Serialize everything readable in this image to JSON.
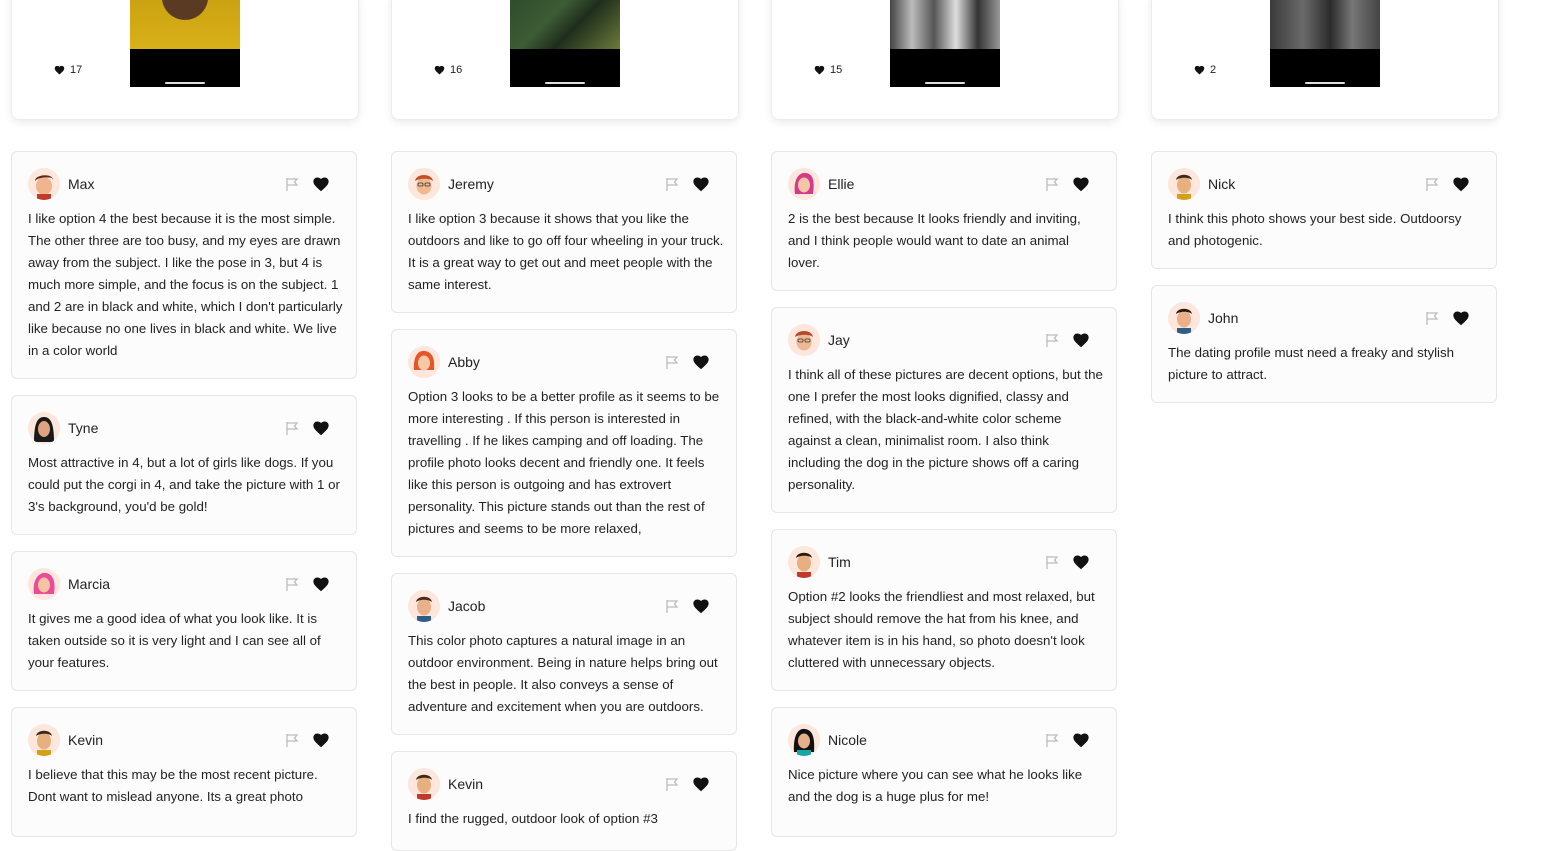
{
  "photos": [
    {
      "likes": "17"
    },
    {
      "likes": "16"
    },
    {
      "likes": "15"
    },
    {
      "likes": "2"
    }
  ],
  "columns": [
    {
      "comments": [
        {
          "name": "Max",
          "text": "I like option 4 the best because it is the most simple. The other three are too busy, and my eyes are drawn away from the subject. I like the pose in 3, but 4 is much more simple, and the focus is on the subject. 1 and 2 are in black and white, which I don't particularly like because no one lives in black and white. We live in a color world"
        },
        {
          "name": "Tyne",
          "text": "Most attractive in 4, but a lot of girls like dogs. If you could put the corgi in 4, and take the picture with 1 or 3's background, you'd be gold!"
        },
        {
          "name": "Marcia",
          "text": "It gives me a good idea of what you look like. It is taken outside so it is very light and I can see all of your features."
        },
        {
          "name": "Kevin",
          "text": "I believe that this may be the most recent picture. Dont want to mislead anyone. Its a great photo"
        }
      ]
    },
    {
      "comments": [
        {
          "name": "Jeremy",
          "text": "I like option 3 because it shows that you like the outdoors and like to go off four wheeling in your truck. It is a great way to get out and meet people with the same interest."
        },
        {
          "name": "Abby",
          "text": "Option 3 looks to be a better profile as it seems to be more interesting . If this person is interested in travelling . If he likes camping and off loading. The profile photo looks decent and friendly one. It feels like this person is outgoing and has extrovert personality. This picture stands out than the rest of pictures and seems to be more relaxed,"
        },
        {
          "name": "Jacob",
          "text": "This color photo captures a natural image in an outdoor environment. Being in nature helps bring out the best in people. It also conveys a sense of adventure and excitement when you are outdoors."
        },
        {
          "name": "Kevin",
          "text": "I find the rugged, outdoor look of option #3"
        }
      ]
    },
    {
      "comments": [
        {
          "name": "Ellie",
          "text": "2 is the best because It looks friendly and inviting, and I think people would want to date an animal lover."
        },
        {
          "name": "Jay",
          "text": "I think all of these pictures are decent options, but the one I prefer the most looks dignified, classy and refined, with the black-and-white color scheme against a clean, minimalist room. I also think including the dog in the picture shows off a caring personality."
        },
        {
          "name": "Tim",
          "text": "Option #2 looks the friendliest and most relaxed, but subject should remove the hat from his knee, and whatever item is in his hand, so photo doesn't look cluttered with unnecessary objects."
        },
        {
          "name": "Nicole",
          "text": "Nice picture where you can see what he looks like and the dog is a huge plus for me!"
        }
      ]
    },
    {
      "comments": [
        {
          "name": "Nick",
          "text": "I think this photo shows your best side. Outdoorsy and photogenic."
        },
        {
          "name": "John",
          "text": "The dating profile must need a freaky and stylish picture to attract."
        }
      ]
    }
  ],
  "icons": {
    "flag": "flag-icon",
    "heart": "heart-icon",
    "likes": "heart-icon"
  },
  "colors": {
    "heart": "#111111",
    "flag": "#bdbdbd",
    "card_border": "#e6e6e6"
  }
}
